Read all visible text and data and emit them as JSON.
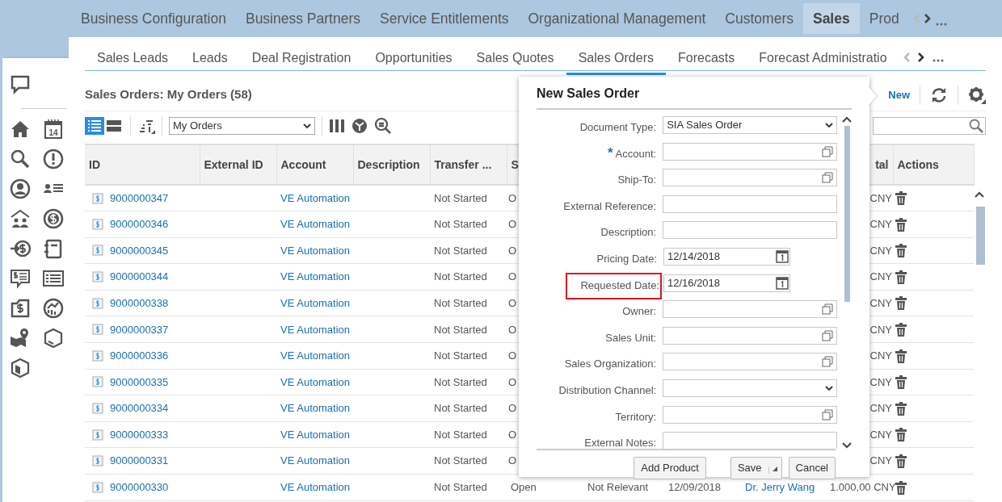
{
  "top_nav": {
    "items": [
      {
        "label": "Business Configuration",
        "selected": false
      },
      {
        "label": "Business Partners",
        "selected": false
      },
      {
        "label": "Service Entitlements",
        "selected": false
      },
      {
        "label": "Organizational Management",
        "selected": false
      },
      {
        "label": "Customers",
        "selected": false
      },
      {
        "label": "Sales",
        "selected": true
      },
      {
        "label": "Prod",
        "selected": false
      }
    ]
  },
  "sidebar": {
    "items": [
      {
        "kind": "chat"
      },
      {
        "kind": "home"
      },
      {
        "kind": "calendar",
        "text": "14"
      },
      {
        "kind": "search"
      },
      {
        "kind": "alert"
      },
      {
        "kind": "person"
      },
      {
        "kind": "contacts"
      },
      {
        "kind": "branch"
      },
      {
        "kind": "dollar"
      },
      {
        "kind": "payment"
      },
      {
        "kind": "notebook"
      },
      {
        "kind": "quote"
      },
      {
        "kind": "list"
      },
      {
        "kind": "invoice"
      },
      {
        "kind": "growth"
      },
      {
        "kind": "map"
      },
      {
        "kind": "cube"
      },
      {
        "kind": "product"
      }
    ]
  },
  "sub_tabs": [
    {
      "label": "Sales Leads",
      "selected": false
    },
    {
      "label": "Leads",
      "selected": false
    },
    {
      "label": "Deal Registration",
      "selected": false
    },
    {
      "label": "Opportunities",
      "selected": false
    },
    {
      "label": "Sales Quotes",
      "selected": false
    },
    {
      "label": "Sales Orders",
      "selected": true
    },
    {
      "label": "Forecasts",
      "selected": false
    },
    {
      "label": "Forecast Administratio",
      "selected": false
    }
  ],
  "list_header": {
    "title": "Sales Orders: My Orders (58)",
    "new_label": "New"
  },
  "toolbar": {
    "views": [
      {
        "kind": "list",
        "selected": true
      },
      {
        "kind": "table",
        "selected": false
      }
    ],
    "query": "My Orders"
  },
  "table": {
    "columns": [
      "ID",
      "External ID",
      "Account",
      "Description",
      "Transfer ...",
      "S",
      "tal",
      "Actions"
    ],
    "rows": [
      {
        "id": "9000000347",
        "account": "VE Automation",
        "transfer": "Not Started",
        "status": "O",
        "total": "CNY"
      },
      {
        "id": "9000000346",
        "account": "VE Automation",
        "transfer": "Not Started",
        "status": "O",
        "total": "CNY"
      },
      {
        "id": "9000000345",
        "account": "VE Automation",
        "transfer": "Not Started",
        "status": "O",
        "total": "CNY"
      },
      {
        "id": "9000000344",
        "account": "VE Automation",
        "transfer": "Not Started",
        "status": "O",
        "total": "CNY"
      },
      {
        "id": "9000000338",
        "account": "VE Automation",
        "transfer": "Not Started",
        "status": "O",
        "total": "CNY"
      },
      {
        "id": "9000000337",
        "account": "VE Automation",
        "transfer": "Not Started",
        "status": "O",
        "total": "CNY"
      },
      {
        "id": "9000000336",
        "account": "VE Automation",
        "transfer": "Not Started",
        "status": "O",
        "total": "CNY"
      },
      {
        "id": "9000000335",
        "account": "VE Automation",
        "transfer": "Not Started",
        "status": "O",
        "total": "CNY"
      },
      {
        "id": "9000000334",
        "account": "VE Automation",
        "transfer": "Not Started",
        "status": "O",
        "total": "CNY"
      },
      {
        "id": "9000000333",
        "account": "VE Automation",
        "transfer": "Not Started",
        "status": "O",
        "total": "CNY"
      },
      {
        "id": "9000000331",
        "account": "VE Automation",
        "transfer": "Not Started",
        "status": "O",
        "total": "CNY"
      },
      {
        "id": "9000000330",
        "account": "VE Automation",
        "transfer": "Not Started",
        "status": "Open",
        "column_7": "Not Relevant",
        "column_8": "12/09/2018",
        "column_9": "Dr. Jerry Wang",
        "total": "1.000,00 CNY"
      }
    ]
  },
  "dialog": {
    "title": "New Sales Order",
    "fields": [
      {
        "label": "Document Type:",
        "kind": "select",
        "value": "SIA Sales Order"
      },
      {
        "label": "Account:",
        "kind": "lookup",
        "marker": "*"
      },
      {
        "label": "Ship-To:",
        "kind": "lookup"
      },
      {
        "label": "External Reference:",
        "kind": "text"
      },
      {
        "label": "Description:",
        "kind": "text"
      },
      {
        "label": "Pricing Date:",
        "kind": "date",
        "value": "12/14/2018"
      },
      {
        "label": "Requested Date:",
        "kind": "date",
        "value": "12/16/2018",
        "highlighted": true
      },
      {
        "label": "Owner:",
        "kind": "lookup"
      },
      {
        "label": "Sales Unit:",
        "kind": "lookup"
      },
      {
        "label": "Sales Organization:",
        "kind": "lookup"
      },
      {
        "label": "Distribution Channel:",
        "kind": "select"
      },
      {
        "label": "Territory:",
        "kind": "lookup"
      },
      {
        "label": "External Notes:",
        "kind": "text"
      }
    ],
    "buttons": [
      {
        "label": "Add Product",
        "kind": "plain"
      },
      {
        "label": "Save",
        "kind": "split"
      },
      {
        "label": "Cancel",
        "kind": "plain"
      }
    ]
  }
}
